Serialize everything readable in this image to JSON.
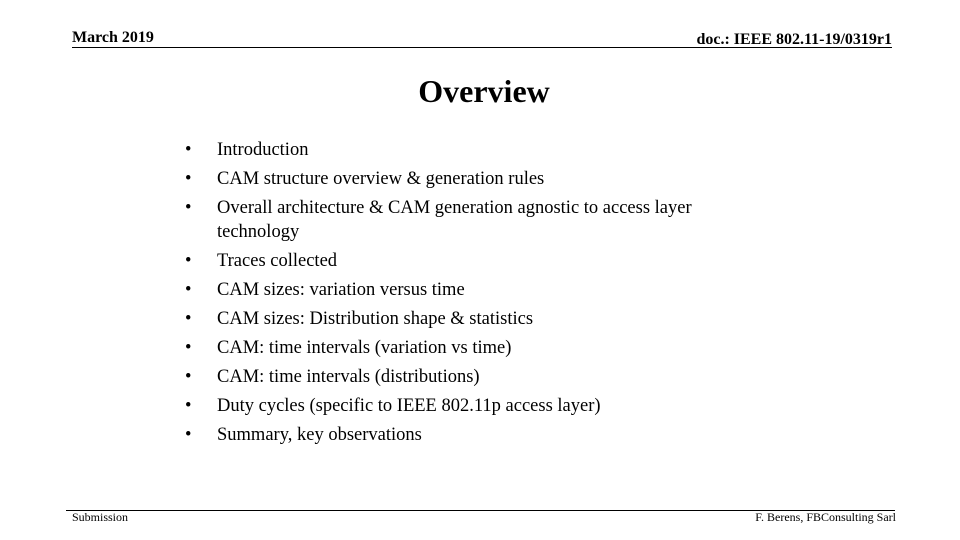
{
  "header": {
    "date": "March 2019",
    "doc_id": "doc.: IEEE 802.11-19/0319r1"
  },
  "slide": {
    "title": "Overview",
    "bullet_glyph": "•",
    "bullets": [
      "Introduction",
      "CAM structure overview & generation rules",
      "Overall architecture & CAM generation agnostic to access layer technology",
      "Traces collected",
      "CAM sizes: variation versus time",
      "CAM sizes: Distribution shape & statistics",
      "CAM: time intervals (variation vs time)",
      "CAM: time intervals (distributions)",
      "Duty cycles (specific to IEEE 802.11p access layer)",
      "Summary, key observations"
    ]
  },
  "footer": {
    "left": "Submission",
    "right": "F. Berens, FBConsulting Sarl"
  }
}
